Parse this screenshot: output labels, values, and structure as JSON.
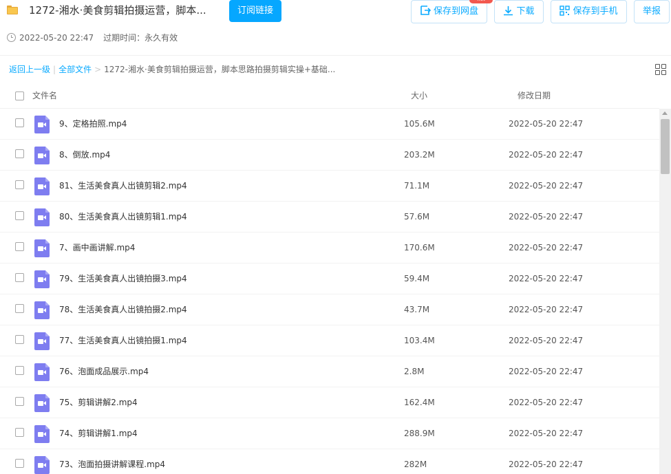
{
  "header": {
    "title": "1272-湘水·美食剪辑拍摄运营，脚本...",
    "subscribe_label": "订阅链接",
    "created_at": "2022-05-20 22:47",
    "expire_label": "过期时间：永久有效",
    "buttons": {
      "save_to_disk": "保存到网盘",
      "download": "下载",
      "save_to_phone": "保存到手机",
      "report": "举报"
    },
    "badge_text": "hot",
    "icons": {
      "folder": "folder-icon",
      "clock": "clock-icon",
      "save": "save-to-disk-icon",
      "download": "download-icon",
      "qr": "qr-code-icon"
    }
  },
  "breadcrumb": {
    "back": "返回上一级",
    "all_files": "全部文件",
    "current": "1272-湘水·美食剪辑拍摄运营，脚本思路拍摄剪辑实操+基础..."
  },
  "table": {
    "columns": {
      "name": "文件名",
      "size": "大小",
      "date": "修改日期"
    },
    "rows": [
      {
        "name": "9、定格拍照.mp4",
        "size": "105.6M",
        "date": "2022-05-20 22:47"
      },
      {
        "name": "8、倒放.mp4",
        "size": "203.2M",
        "date": "2022-05-20 22:47"
      },
      {
        "name": "81、生活美食真人出镜剪辑2.mp4",
        "size": "71.1M",
        "date": "2022-05-20 22:47"
      },
      {
        "name": "80、生活美食真人出镜剪辑1.mp4",
        "size": "57.6M",
        "date": "2022-05-20 22:47"
      },
      {
        "name": "7、画中画讲解.mp4",
        "size": "170.6M",
        "date": "2022-05-20 22:47"
      },
      {
        "name": "79、生活美食真人出镜拍摄3.mp4",
        "size": "59.4M",
        "date": "2022-05-20 22:47"
      },
      {
        "name": "78、生活美食真人出镜拍摄2.mp4",
        "size": "43.7M",
        "date": "2022-05-20 22:47"
      },
      {
        "name": "77、生活美食真人出镜拍摄1.mp4",
        "size": "103.4M",
        "date": "2022-05-20 22:47"
      },
      {
        "name": "76、泡面成品展示.mp4",
        "size": "2.8M",
        "date": "2022-05-20 22:47"
      },
      {
        "name": "75、剪辑讲解2.mp4",
        "size": "162.4M",
        "date": "2022-05-20 22:47"
      },
      {
        "name": "74、剪辑讲解1.mp4",
        "size": "288.9M",
        "date": "2022-05-20 22:47"
      },
      {
        "name": "73、泡面拍摄讲解课程.mp4",
        "size": "282M",
        "date": "2022-05-20 22:47"
      }
    ],
    "file_icon": "video-file-icon"
  },
  "colors": {
    "accent": "#06a7ff",
    "link": "#09aaff",
    "video_icon": "#7e7df0",
    "badge": "#f2584f"
  }
}
